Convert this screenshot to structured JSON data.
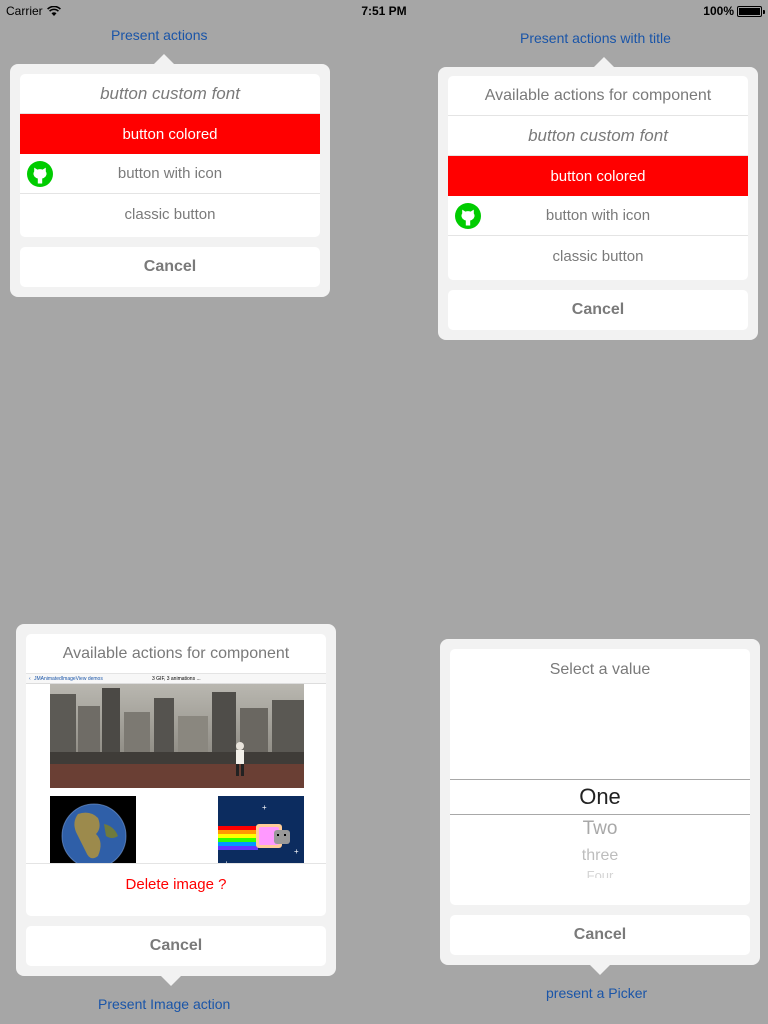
{
  "status_bar": {
    "carrier": "Carrier",
    "time": "7:51 PM",
    "battery": "100%"
  },
  "triggers": {
    "present_actions": "Present actions",
    "present_actions_with_title": "Present actions with title",
    "present_image_action": "Present Image action",
    "present_picker": "present a Picker"
  },
  "popover_actions": {
    "buttons": [
      "button custom font",
      "button colored",
      "button with icon",
      "classic button"
    ],
    "cancel": "Cancel"
  },
  "popover_actions_title": {
    "title": "Available actions for component",
    "buttons": [
      "button custom font",
      "button colored",
      "button with icon",
      "classic button"
    ],
    "cancel": "Cancel"
  },
  "popover_image": {
    "title": "Available actions for component",
    "embedded_nav_back": "JMAnimatedImageView demos",
    "embedded_nav_title": "3 GIF, 3 animations ...",
    "delete": "Delete image ?",
    "cancel": "Cancel"
  },
  "popover_picker": {
    "title": "Select a value",
    "options": [
      "One",
      "Two",
      "three",
      "Four"
    ],
    "selected": "One",
    "cancel": "Cancel"
  },
  "colors": {
    "background": "#a6a6a6",
    "accent_link": "#1a55a8",
    "colored_button": "#ff0000",
    "destructive": "#ff0000",
    "github_icon": "#00cc00"
  },
  "icons": [
    "wifi-icon",
    "battery-icon",
    "github-icon",
    "back-chevron-icon"
  ]
}
